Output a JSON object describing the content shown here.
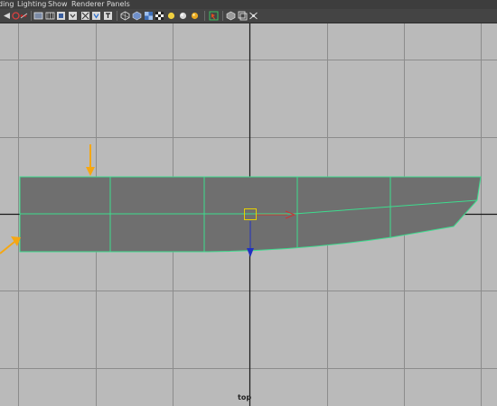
{
  "menu": {
    "items": [
      "ding",
      "Lighting",
      "Show",
      "Renderer",
      "Panels"
    ]
  },
  "toolbar": {
    "icons": [
      "select-camera-icon",
      "grid-toggle-icon",
      "bookmark-icon",
      "wireframe-icon",
      "film-gate-icon",
      "resolution-gate-icon",
      "field-chart-icon",
      "safe-action-icon",
      "safe-title-icon",
      "smooth-wireframe-icon",
      "smooth-shade-icon",
      "textured-icon",
      "default-light-icon",
      "all-lights-icon",
      "shadows-icon",
      "isolate-select-icon",
      "xray-icon",
      "xray-joints-icon",
      "xray-components-icon"
    ]
  },
  "viewport": {
    "camera_label": "top",
    "background_color": "#bababa",
    "mesh_color": "#6f6f6f",
    "wire_color": "#3ddc8e",
    "axis_color": "#1a1a1a",
    "arrow_color": "#f5a712",
    "gizmo_x_color": "#d03030",
    "gizmo_y_color": "#2030c0",
    "gizmo_center_color": "#e6d000"
  }
}
